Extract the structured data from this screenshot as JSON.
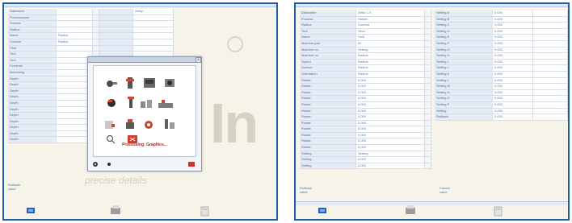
{
  "left_panel": {
    "property_grid": {
      "rows": [
        {
          "label": "Dataname",
          "value": "",
          "right_label": "",
          "right_value": "Setup"
        },
        {
          "label": "Processname",
          "value": "",
          "right_label": "",
          "right_value": ""
        },
        {
          "label": "Surface",
          "value": "",
          "right_label": "",
          "right_value": ""
        },
        {
          "label": "Radius",
          "value": "",
          "right_label": "",
          "right_value": ""
        },
        {
          "label": "Name",
          "value": "Radius",
          "right_label": "",
          "right_value": ""
        },
        {
          "label": "Contour",
          "value": "Radius",
          "right_label": "",
          "right_value": ""
        },
        {
          "label": "Fillet",
          "value": "",
          "right_label": "",
          "right_value": ""
        },
        {
          "label": "Tool",
          "value": "",
          "right_label": "",
          "right_value": ""
        },
        {
          "label": "Tool",
          "value": "",
          "right_label": "",
          "right_value": ""
        },
        {
          "label": "Feedrate",
          "value": "",
          "right_label": "",
          "right_value": ""
        },
        {
          "label": "Machining",
          "value": "",
          "right_label": "",
          "right_value": ""
        },
        {
          "label": "Depth",
          "value": "",
          "right_label": "",
          "right_value": ""
        },
        {
          "label": "Depth",
          "value": "",
          "right_label": "",
          "right_value": ""
        },
        {
          "label": "Depth",
          "value": "",
          "right_label": "",
          "right_value": ""
        },
        {
          "label": "Depth",
          "value": "",
          "right_label": "",
          "right_value": ""
        },
        {
          "label": "Depth",
          "value": "",
          "right_label": "",
          "right_value": ""
        },
        {
          "label": "Depth",
          "value": "",
          "right_label": "",
          "right_value": ""
        },
        {
          "label": "Depth",
          "value": "",
          "right_label": "",
          "right_value": ""
        },
        {
          "label": "Depth",
          "value": "",
          "right_label": "",
          "right_value": ""
        },
        {
          "label": "Depth",
          "value": "",
          "right_label": "",
          "right_value": ""
        },
        {
          "label": "Depth",
          "value": "",
          "right_label": "",
          "right_value": ""
        },
        {
          "label": "Depth",
          "value": "",
          "right_label": "",
          "right_value": ""
        }
      ]
    },
    "watermark_big": "In",
    "watermark_sub": "precise   details",
    "icon_dialog": {
      "title": "",
      "close": "x",
      "caption": "Processing: Graphics...",
      "icons": [
        "tool-icon",
        "spindle-icon",
        "machine-icon",
        "camera-icon",
        "fixture-icon",
        "drill-icon",
        "mill-icon",
        "lathe-icon",
        "chuck-icon",
        "clamp-icon",
        "turret-icon",
        "probe-icon",
        "gear-icon",
        "search-icon",
        "stop-icon"
      ]
    },
    "note_text": [
      "Rollback",
      "value"
    ]
  },
  "right_panel": {
    "left_grid": [
      {
        "label": "Dataname",
        "value": "Delta 1.0"
      },
      {
        "label": "Process",
        "value": "Hollow"
      },
      {
        "label": "Radius",
        "value": "Contour"
      },
      {
        "label": "Tool",
        "value": "Slice"
      },
      {
        "label": "Name",
        "value": "Hold"
      },
      {
        "label": "Machine part",
        "value": "ID"
      },
      {
        "label": "Machine no.",
        "value": "Setting"
      },
      {
        "label": "Machine no.",
        "value": "Radius"
      },
      {
        "label": "Speed",
        "value": "Radius"
      },
      {
        "label": "Surface",
        "value": "Radius"
      },
      {
        "label": "Orientation",
        "value": "Radius"
      },
      {
        "label": "Rotate",
        "value": "0,000"
      },
      {
        "label": "Rotate",
        "value": "0,000"
      },
      {
        "label": "Rotate",
        "value": "0,000"
      },
      {
        "label": "Rotate",
        "value": "0,000"
      },
      {
        "label": "Rotate",
        "value": "0,000"
      },
      {
        "label": "Rotate",
        "value": "0,000"
      },
      {
        "label": "Rotate",
        "value": "0,000"
      },
      {
        "label": "Rotate",
        "value": "0,000"
      },
      {
        "label": "Rotate",
        "value": "0,000"
      },
      {
        "label": "Rotate",
        "value": "0,000"
      },
      {
        "label": "Rotate",
        "value": "0,000"
      },
      {
        "label": "Rotate",
        "value": "0,000"
      },
      {
        "label": "Setting",
        "value": "Setting"
      },
      {
        "label": "Setting",
        "value": "0,000"
      },
      {
        "label": "Setting",
        "value": "0,000"
      }
    ],
    "right_grid": [
      {
        "label": "Setting A",
        "value": "0,000"
      },
      {
        "label": "Setting B",
        "value": "0,000"
      },
      {
        "label": "Setting C",
        "value": "0,000"
      },
      {
        "label": "Setting D",
        "value": "0,000"
      },
      {
        "label": "Setting E",
        "value": "0,000"
      },
      {
        "label": "Setting F",
        "value": "0,000"
      },
      {
        "label": "Setting G",
        "value": "0,000"
      },
      {
        "label": "Setting H",
        "value": "0,000"
      },
      {
        "label": "Setting I",
        "value": "0,000"
      },
      {
        "label": "Setting J",
        "value": "0,000"
      },
      {
        "label": "Setting K",
        "value": "0,000"
      },
      {
        "label": "Setting L",
        "value": "0,000"
      },
      {
        "label": "Setting M",
        "value": "0,000"
      },
      {
        "label": "Setting N",
        "value": "0,000"
      },
      {
        "label": "Setting O",
        "value": "0,000"
      },
      {
        "label": "Setting P",
        "value": "0,000"
      },
      {
        "label": "Setting",
        "value": "0,000"
      },
      {
        "label": "Rollback",
        "value": "0,000"
      }
    ],
    "note_text": [
      "Rollback",
      "value"
    ],
    "note_text_right": [
      "Cancel",
      "value"
    ]
  }
}
